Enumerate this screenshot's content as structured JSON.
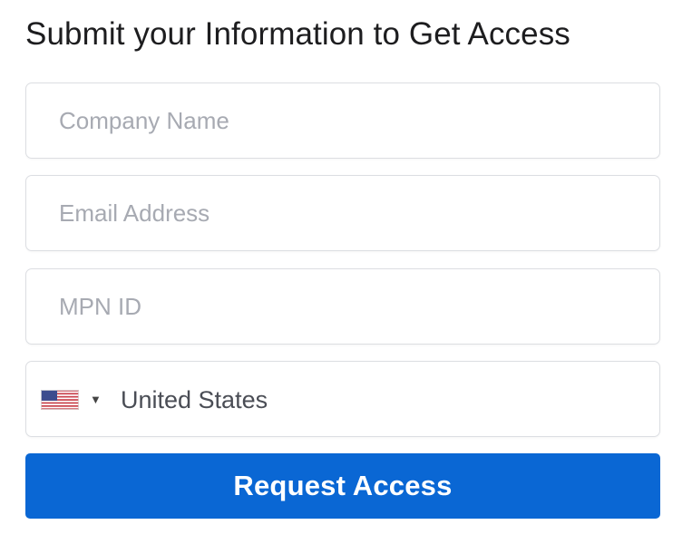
{
  "form": {
    "title": "Submit your Information to Get Access",
    "fields": [
      {
        "placeholder": "Company Name",
        "value": ""
      },
      {
        "placeholder": "Email Address",
        "value": ""
      },
      {
        "placeholder": "MPN ID",
        "value": ""
      }
    ],
    "country": {
      "selected": "United States",
      "flag_icon": "us-flag-icon",
      "caret_icon": "caret-down-icon"
    },
    "submit_label": "Request Access"
  },
  "colors": {
    "accent": "#0a67d4",
    "field_border": "#dcdee2",
    "placeholder": "#a7aab2",
    "title": "#1d1d1f"
  }
}
